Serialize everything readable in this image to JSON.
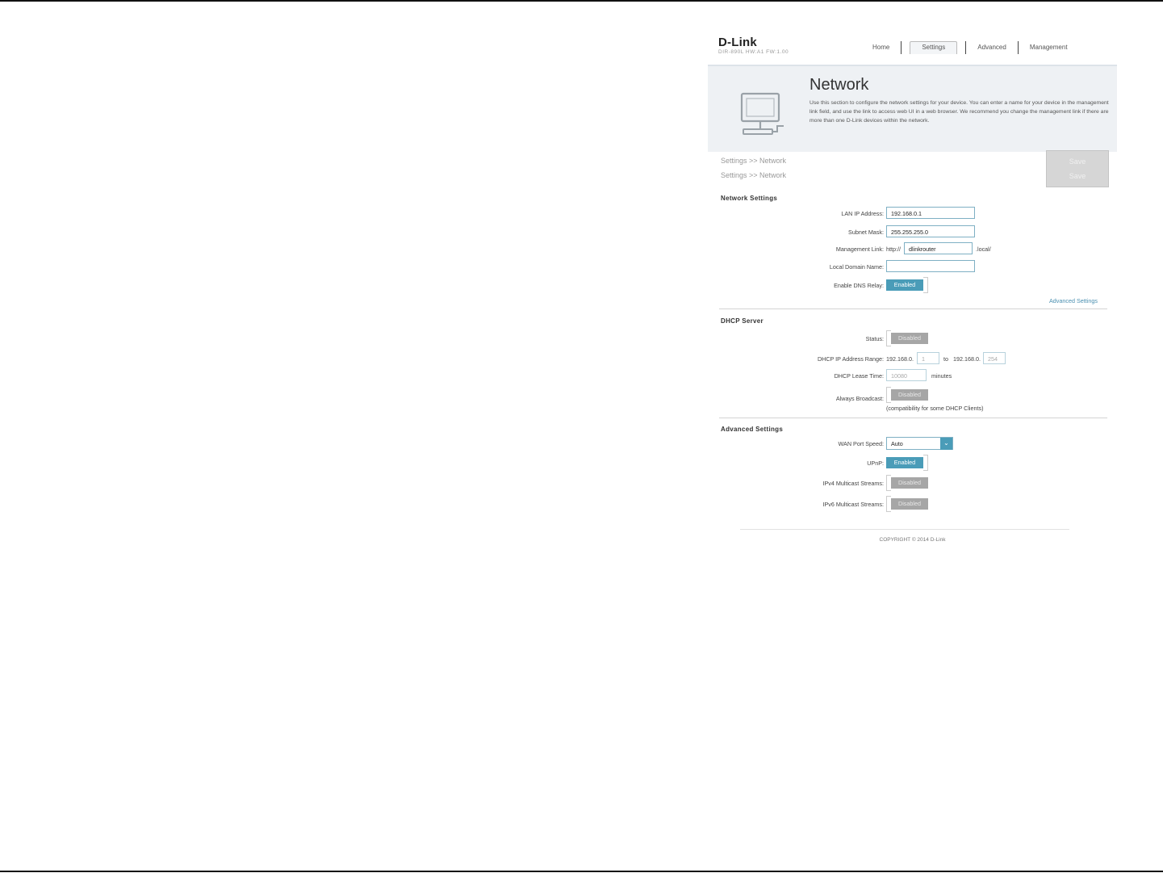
{
  "brand": {
    "logo": "D-Link",
    "subtitle": "DIR-890L  HW:A1  FW:1.00"
  },
  "nav": {
    "home": "Home",
    "settings": "Settings",
    "advanced": "Advanced",
    "management": "Management"
  },
  "banner": {
    "title": "Network",
    "description": "Use this section to configure the network settings for your device. You can enter a name for your device in the management link field, and use the link to access web UI in a web browser. We recommend you change the management link if there are more than one D-Link devices within the network."
  },
  "breadcrumb": {
    "line1": "Settings >> Network",
    "line2": "Settings >> Network"
  },
  "save": {
    "label1": "Save",
    "label2": "Save"
  },
  "network_settings": {
    "title": "Network Settings",
    "lan_ip_label": "LAN IP Address:",
    "lan_ip_value": "192.168.0.1",
    "subnet_label": "Subnet Mask:",
    "subnet_value": "255.255.255.0",
    "mgmt_label": "Management Link:",
    "mgmt_prefix": "http://",
    "mgmt_value": "dlinkrouter",
    "mgmt_suffix": ".local/",
    "domain_label": "Local Domain Name:",
    "domain_value": "",
    "dns_relay_label": "Enable DNS Relay:",
    "dns_relay_state": "Enabled",
    "advanced_link": "Advanced Settings"
  },
  "dhcp": {
    "title": "DHCP Server",
    "status_label": "Status:",
    "status_state": "Disabled",
    "range_label": "DHCP IP Address Range:",
    "range_prefix1": "192.168.0.",
    "range_start": "1",
    "range_to": "to",
    "range_prefix2": "192.168.0.",
    "range_end": "254",
    "lease_label": "DHCP Lease Time:",
    "lease_value": "10080",
    "lease_unit": "minutes",
    "broadcast_label": "Always Broadcast:",
    "broadcast_state": "Disabled",
    "broadcast_note": "(compatibility for some DHCP Clients)"
  },
  "advanced": {
    "title": "Advanced Settings",
    "wan_label": "WAN Port Speed:",
    "wan_value": "Auto",
    "upnp_label": "UPnP:",
    "upnp_state": "Enabled",
    "ipv4_label": "IPv4 Multicast Streams:",
    "ipv4_state": "Disabled",
    "ipv6_label": "IPv6 Multicast Streams:",
    "ipv6_state": "Disabled"
  },
  "footer": {
    "copyright": "COPYRIGHT © 2014 D-Link"
  },
  "icons": {
    "monitor": "monitor-icon",
    "dropdown": "chevron-down-icon"
  },
  "colors": {
    "accent": "#4a9cb8",
    "disabled": "#a6a6a6",
    "banner": "#eef1f4"
  }
}
